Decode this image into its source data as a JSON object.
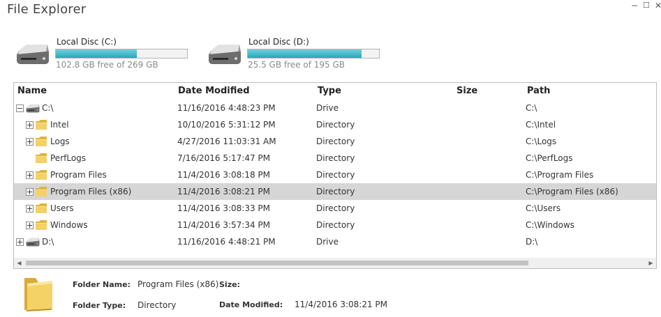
{
  "window": {
    "title": "File Explorer",
    "minimize": "−",
    "maximize": "☐",
    "close": "✕"
  },
  "drives": [
    {
      "name": "Local Disc (C:)",
      "free_text": "102.8 GB free of 269 GB",
      "used_fraction": 0.618
    },
    {
      "name": "Local Disc (D:)",
      "free_text": "25.5 GB free of 195 GB",
      "used_fraction": 0.869
    }
  ],
  "columns": {
    "name": "Name",
    "date_modified": "Date Modified",
    "type": "Type",
    "size": "Size",
    "path": "Path"
  },
  "rows": [
    {
      "name": "C:\\",
      "date": "11/16/2016 4:48:23 PM",
      "type": "Drive",
      "size": "",
      "path": "C:\\",
      "level": 0,
      "icon": "drive-icon",
      "expander": "minus",
      "selected": false
    },
    {
      "name": "Intel",
      "date": "10/10/2016 5:31:12 PM",
      "type": "Directory",
      "size": "",
      "path": "C:\\Intel",
      "level": 1,
      "icon": "folder-icon",
      "expander": "plus",
      "selected": false
    },
    {
      "name": "Logs",
      "date": "4/27/2016 11:03:31 AM",
      "type": "Directory",
      "size": "",
      "path": "C:\\Logs",
      "level": 1,
      "icon": "folder-icon",
      "expander": "plus",
      "selected": false
    },
    {
      "name": "PerfLogs",
      "date": "7/16/2016 5:17:47 PM",
      "type": "Directory",
      "size": "",
      "path": "C:\\PerfLogs",
      "level": 1,
      "icon": "folder-icon",
      "expander": "none",
      "selected": false
    },
    {
      "name": "Program Files",
      "date": "11/4/2016 3:08:18 PM",
      "type": "Directory",
      "size": "",
      "path": "C:\\Program Files",
      "level": 1,
      "icon": "folder-icon",
      "expander": "plus",
      "selected": false
    },
    {
      "name": "Program Files (x86)",
      "date": "11/4/2016 3:08:21 PM",
      "type": "Directory",
      "size": "",
      "path": "C:\\Program Files (x86)",
      "level": 1,
      "icon": "folder-icon",
      "expander": "plus",
      "selected": true
    },
    {
      "name": "Users",
      "date": "11/4/2016 3:08:33 PM",
      "type": "Directory",
      "size": "",
      "path": "C:\\Users",
      "level": 1,
      "icon": "folder-icon",
      "expander": "plus",
      "selected": false
    },
    {
      "name": "Windows",
      "date": "11/4/2016 3:57:34 PM",
      "type": "Directory",
      "size": "",
      "path": "C:\\Windows",
      "level": 1,
      "icon": "folder-icon",
      "expander": "plus",
      "selected": false
    },
    {
      "name": "D:\\",
      "date": "11/16/2016 4:48:21 PM",
      "type": "Drive",
      "size": "",
      "path": "D:\\",
      "level": 0,
      "icon": "drive-icon",
      "expander": "plus",
      "selected": false
    }
  ],
  "scrollbar": {
    "left_arrow": "◀",
    "right_arrow": "▶"
  },
  "details": {
    "folder_name_label": "Folder Name:",
    "folder_name": "Program Files (x86)",
    "size_label": "Size:",
    "size": "",
    "folder_type_label": "Folder Type:",
    "folder_type": "Directory",
    "date_modified_label": "Date Modified:",
    "date_modified": "11/4/2016 3:08:21 PM"
  },
  "colors": {
    "bar_fill": "#2aa6b8",
    "selected_row": "#d6d6d6",
    "folder": "#f2cc55"
  }
}
